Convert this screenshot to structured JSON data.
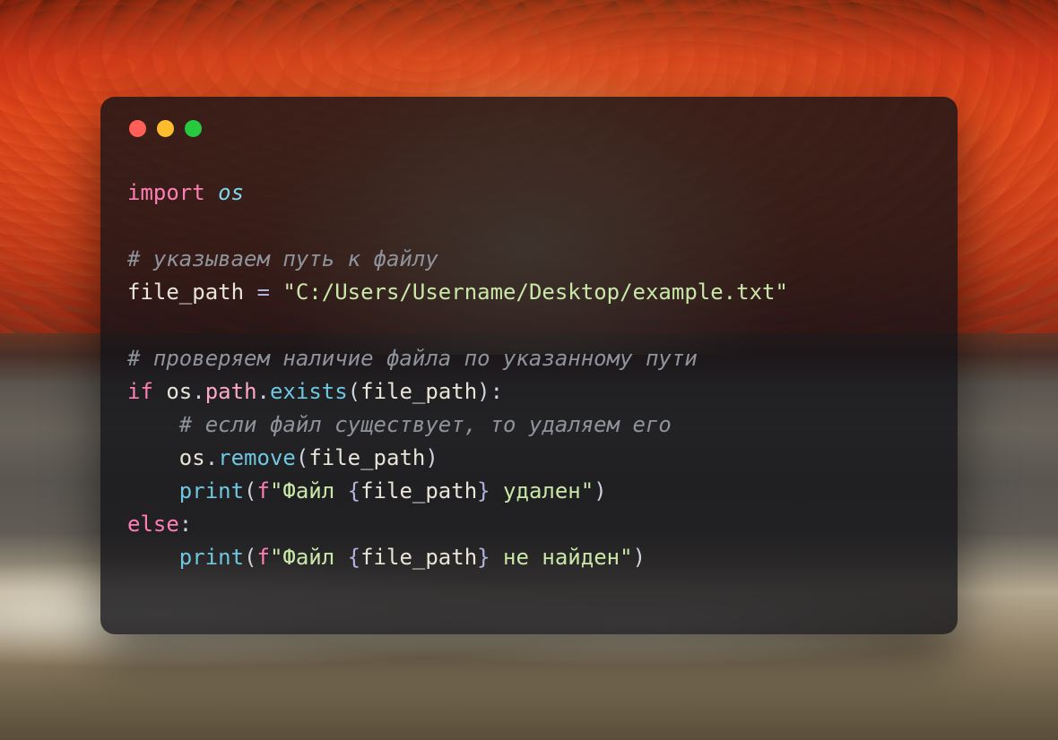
{
  "code": {
    "line1": {
      "kw_import": "import",
      "mod": "os"
    },
    "line2": {
      "comment": "# указываем путь к файлу"
    },
    "line3": {
      "var": "file_path",
      "eq": "=",
      "str": "\"C:/Users/Username/Desktop/example.txt\""
    },
    "line4": {
      "comment": "# проверяем наличие файла по указанному пути"
    },
    "line5": {
      "kw_if": "if",
      "obj": "os",
      "dot1": ".",
      "attr": "path",
      "dot2": ".",
      "fn": "exists",
      "lp": "(",
      "arg": "file_path",
      "rp": ")",
      "colon": ":"
    },
    "line6": {
      "comment": "# если файл существует, то удаляем его"
    },
    "line7": {
      "obj": "os",
      "dot": ".",
      "fn": "remove",
      "lp": "(",
      "arg": "file_path",
      "rp": ")"
    },
    "line8": {
      "fn": "print",
      "lp": "(",
      "f": "f",
      "q1": "\"",
      "txt1": "Файл ",
      "lb": "{",
      "interp": "file_path",
      "rb": "}",
      "txt2": " удален",
      "q2": "\"",
      "rp": ")"
    },
    "line9": {
      "kw_else": "else",
      "colon": ":"
    },
    "line10": {
      "fn": "print",
      "lp": "(",
      "f": "f",
      "q1": "\"",
      "txt1": "Файл ",
      "lb": "{",
      "interp": "file_path",
      "rb": "}",
      "txt2": " не найден",
      "q2": "\"",
      "rp": ")"
    }
  },
  "indent": "    "
}
